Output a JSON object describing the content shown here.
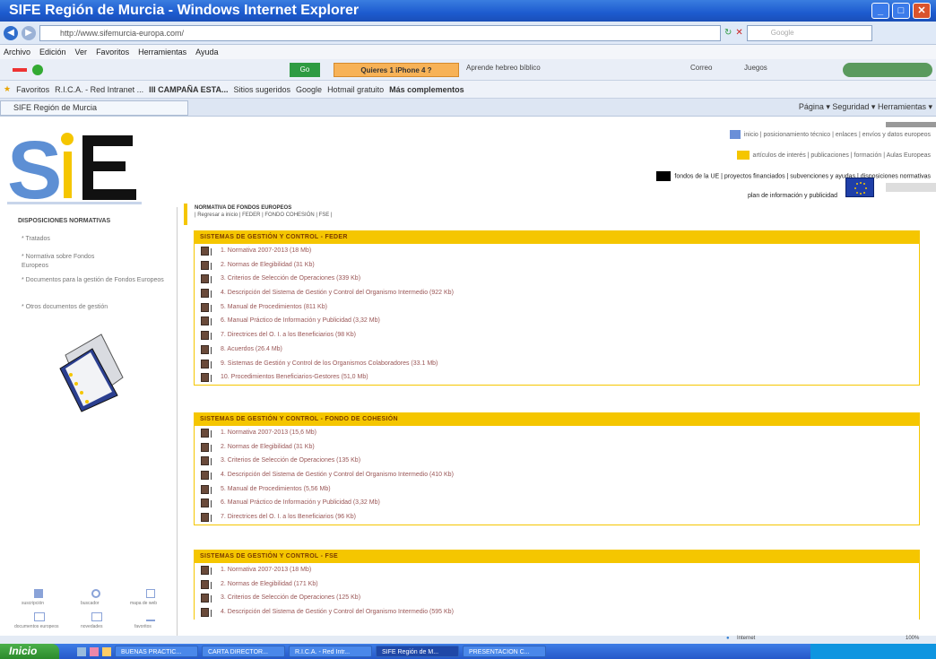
{
  "window": {
    "title": "SIFE Región de Murcia - Windows Internet Explorer"
  },
  "address": {
    "url": "http://www.sifemurcia-europa.com/",
    "search_placeholder": "Google"
  },
  "menu": [
    "Archivo",
    "Edición",
    "Ver",
    "Favoritos",
    "Herramientas",
    "Ayuda"
  ],
  "toolbar": {
    "go_label": "Go",
    "orange_label": "Quieres 1 iPhone 4 ?",
    "aprende": "Aprende hebreo bíblico",
    "correo": "Correo",
    "juegos": "Juegos"
  },
  "favorites": {
    "label": "Favoritos",
    "items": [
      "R.I.C.A. - Red Intranet ...",
      "III CAMPAÑA ESTA...",
      "Sitios sugeridos",
      "Google",
      "Hotmail gratuito",
      "Más complementos"
    ]
  },
  "tab": {
    "title": "SIFE Región de Murcia",
    "tools": "Página ▾  Seguridad ▾  Herramientas ▾"
  },
  "site": {
    "logo": "SIFE",
    "top_links_1": "inicio | posicionamiento técnico | enlaces | envíos y datos europeos",
    "top_links_2": "artículos de interés | publicaciones | formación | Aulas Europeas",
    "top_links_3": "fondos de la UE | proyectos financiados | subvenciones y ayudas | disposiciones normativas",
    "top_links_4": "plan de información y publicidad"
  },
  "sidebar": {
    "title": "DISPOSICIONES NORMATIVAS",
    "items": [
      "* Tratados",
      "* Normativa sobre Fondos Europeos",
      "* Documentos para la gestión de Fondos Europeos",
      "* Otros documentos de gestión"
    ],
    "bottom_icons": [
      "suscripción",
      "buscador",
      "mapa de web",
      "documentos europeos",
      "novedades",
      "favoritos"
    ]
  },
  "main": {
    "header": "NORMATIVA DE FONDOS EUROPEOS",
    "links": "| Regresar a inicio | FEDER | FONDO COHESIÓN | FSE |",
    "sections": [
      {
        "title": "SISTEMAS DE GESTIÓN Y CONTROL - FEDER",
        "items": [
          "1. Normativa 2007-2013 (18 Mb)",
          "2. Normas de Elegibilidad (31 Kb)",
          "3. Criterios de Selección de Operaciones (339 Kb)",
          "4. Descripción del Sistema de Gestión y Control del Organismo Intermedio (922 Kb)",
          "5. Manual de Procedimientos (811 Kb)",
          "6. Manual Práctico de Información y Publicidad (3,32 Mb)",
          "7. Directrices del O. I. a los Beneficiarios (98 Kb)",
          "8. Acuerdos (26.4 Mb)",
          "9. Sistemas de Gestión y Control de los Organismos Colaboradores (33.1 Mb)",
          "10. Procedimientos Beneficiarios-Gestores (51,0 Mb)"
        ]
      },
      {
        "title": "SISTEMAS DE GESTIÓN Y CONTROL - FONDO DE COHESIÓN",
        "items": [
          "1. Normativa 2007-2013 (15,6 Mb)",
          "2. Normas de Elegibilidad (31 Kb)",
          "3. Criterios de Selección de Operaciones (135 Kb)",
          "4. Descripción del Sistema de Gestión y Control del Organismo Intermedio (410 Kb)",
          "5. Manual de Procedimientos (5,56 Mb)",
          "6. Manual Práctico de Información y Publicidad (3,32 Mb)",
          "7. Directrices del O. I. a los Beneficiarios (96 Kb)"
        ]
      },
      {
        "title": "SISTEMAS DE GESTIÓN Y CONTROL - FSE",
        "items": [
          "1. Normativa 2007-2013 (18 Mb)",
          "2. Normas de Elegibilidad (171 Kb)",
          "3. Criterios de Selección de Operaciones (125 Kb)",
          "4. Descripción del Sistema de Gestión y Control del Organismo Intermedio (595 Kb)"
        ]
      }
    ]
  },
  "status": {
    "zone": "Internet",
    "zoom": "100%"
  },
  "taskbar": {
    "start": "Inicio",
    "items": [
      "BUENAS PRACTIC...",
      "CARTA DIRECTOR...",
      "R.I.C.A. - Red Intr...",
      "SIFE Región de M...",
      "PRESENTACION C..."
    ]
  }
}
